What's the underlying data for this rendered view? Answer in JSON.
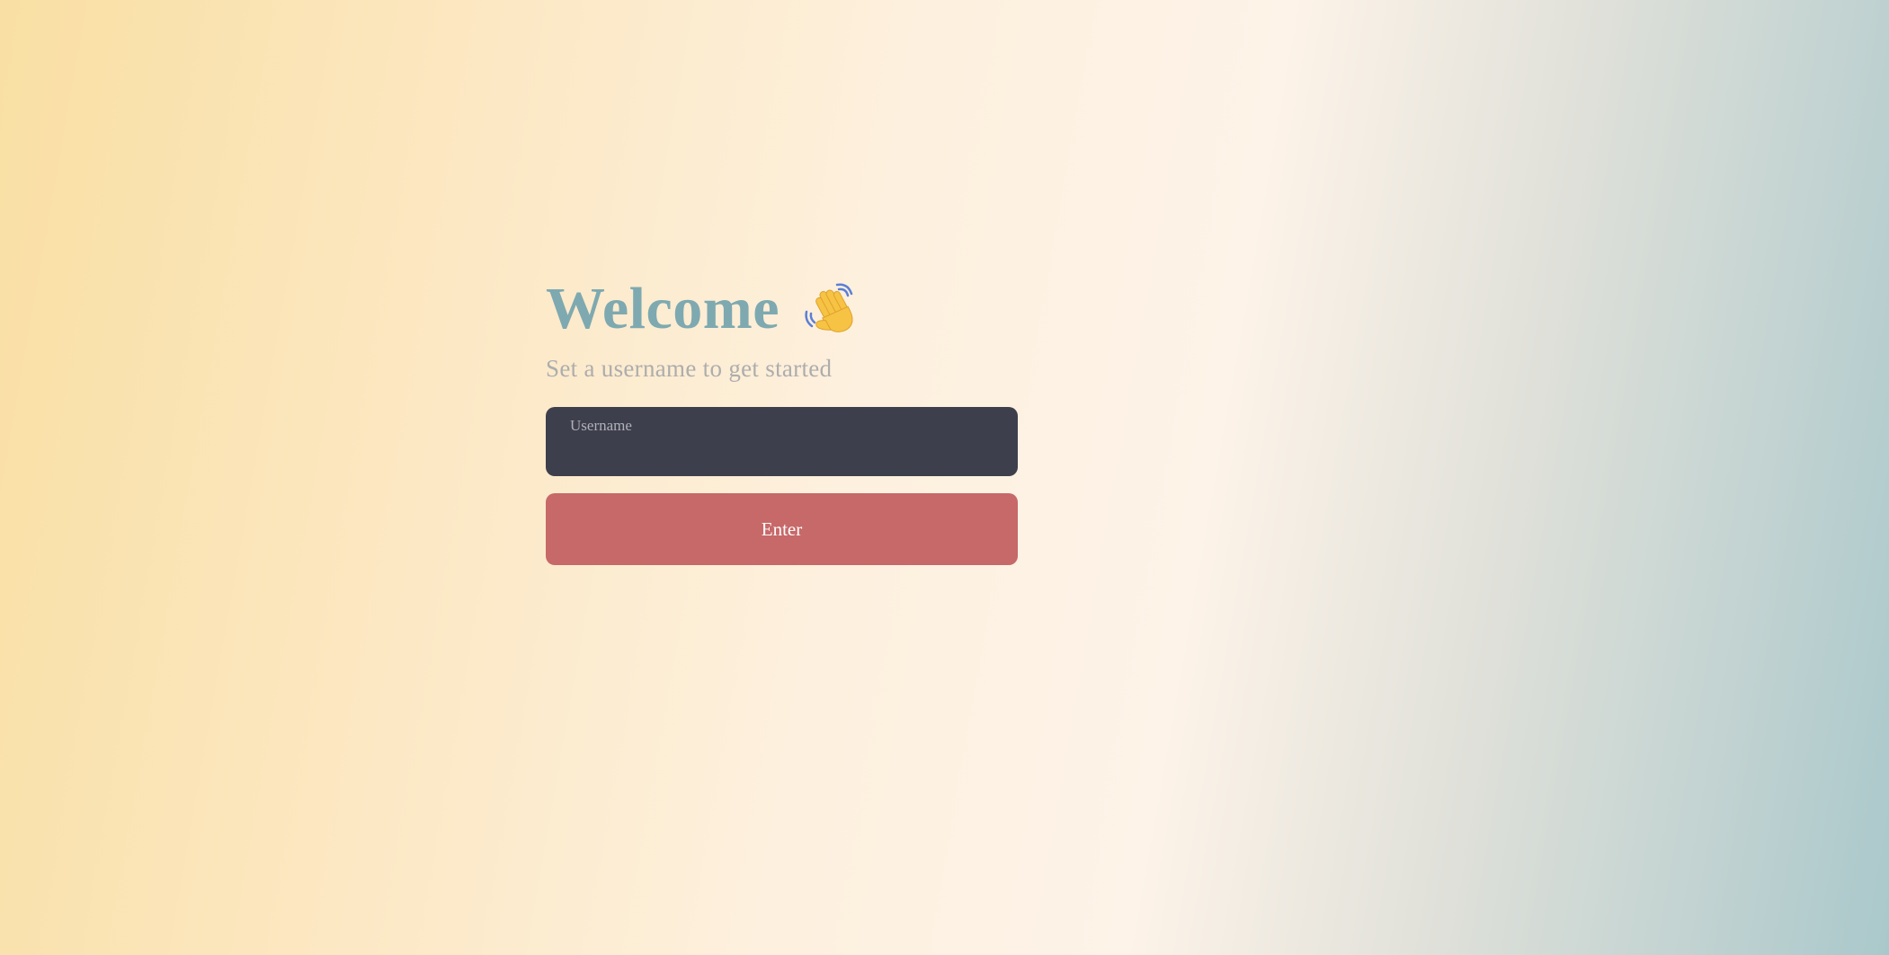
{
  "welcome": {
    "title": "Welcome",
    "icon": "waving-hand-icon",
    "subtitle": "Set a username to get started"
  },
  "form": {
    "username_label": "Username",
    "username_value": "",
    "enter_label": "Enter"
  },
  "colors": {
    "title": "#7ea9b0",
    "input_bg": "#3e3f4c",
    "button_bg": "#c76869"
  }
}
